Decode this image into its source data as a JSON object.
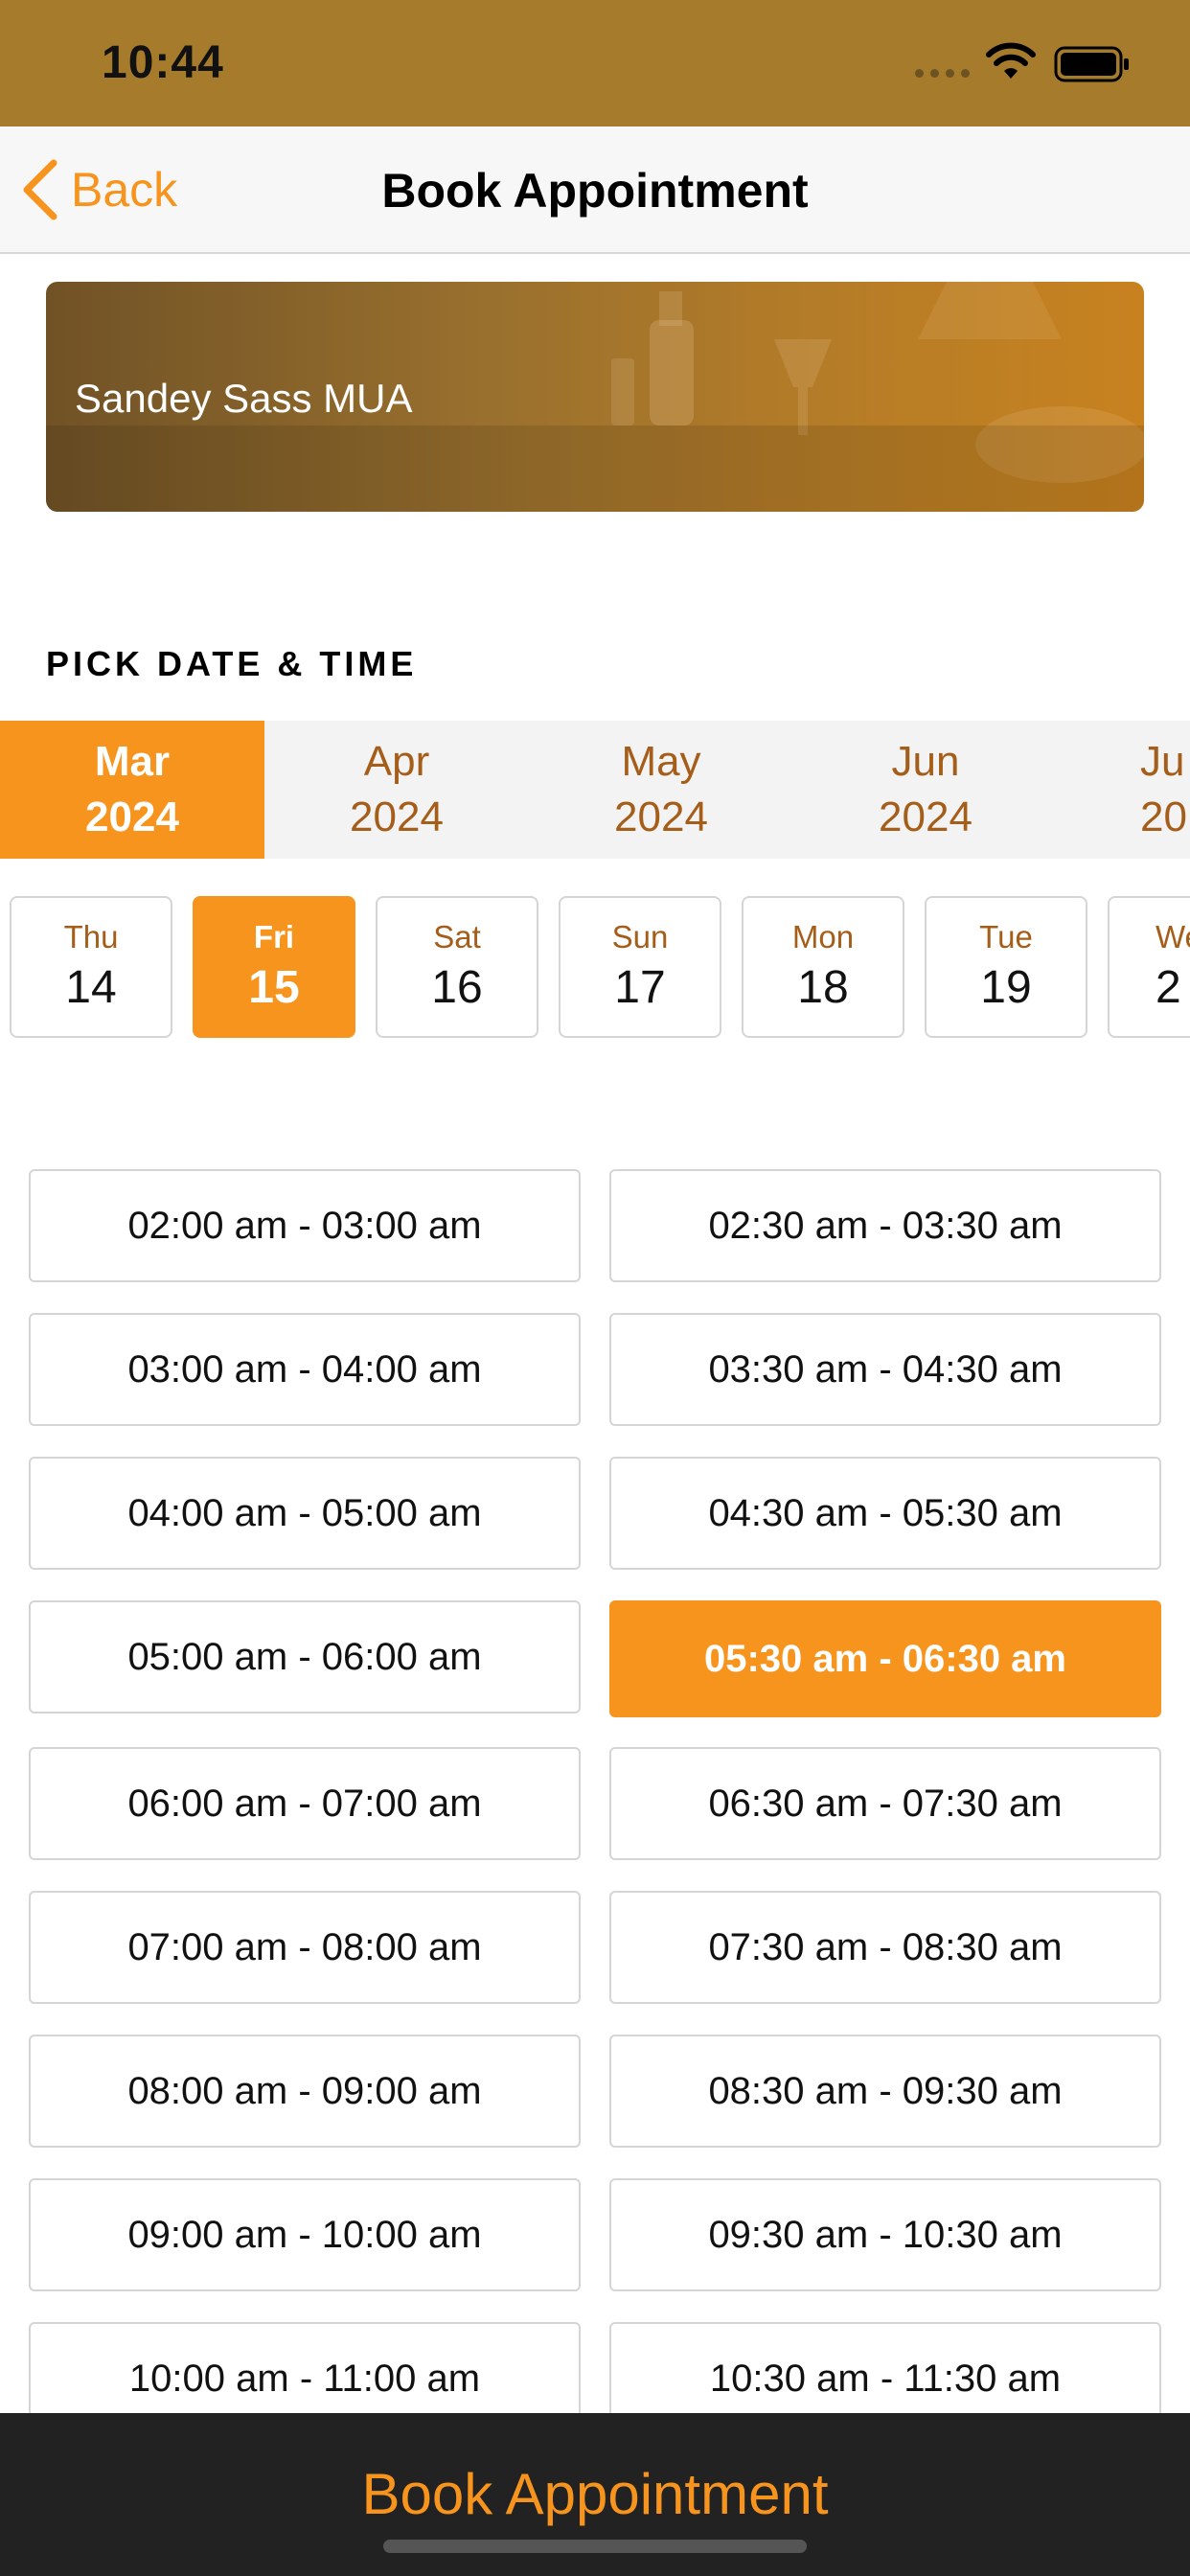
{
  "status_bar": {
    "time": "10:44"
  },
  "nav": {
    "back_label": "Back",
    "title": "Book Appointment"
  },
  "banner": {
    "name": "Sandey Sass MUA"
  },
  "section": {
    "label": "PICK DATE & TIME"
  },
  "months": [
    {
      "month": "Mar",
      "year": "2024",
      "selected": true
    },
    {
      "month": "Apr",
      "year": "2024",
      "selected": false
    },
    {
      "month": "May",
      "year": "2024",
      "selected": false
    },
    {
      "month": "Jun",
      "year": "2024",
      "selected": false
    },
    {
      "month": "Ju",
      "year": "20",
      "selected": false
    }
  ],
  "days": [
    {
      "name": "Thu",
      "num": "14",
      "selected": false
    },
    {
      "name": "Fri",
      "num": "15",
      "selected": true
    },
    {
      "name": "Sat",
      "num": "16",
      "selected": false
    },
    {
      "name": "Sun",
      "num": "17",
      "selected": false
    },
    {
      "name": "Mon",
      "num": "18",
      "selected": false
    },
    {
      "name": "Tue",
      "num": "19",
      "selected": false
    },
    {
      "name": "We",
      "num": "2",
      "selected": false
    }
  ],
  "slots": [
    {
      "label": "02:00 am - 03:00 am",
      "selected": false
    },
    {
      "label": "02:30 am - 03:30 am",
      "selected": false
    },
    {
      "label": "03:00 am - 04:00 am",
      "selected": false
    },
    {
      "label": "03:30 am - 04:30 am",
      "selected": false
    },
    {
      "label": "04:00 am - 05:00 am",
      "selected": false
    },
    {
      "label": "04:30 am - 05:30 am",
      "selected": false
    },
    {
      "label": "05:00 am - 06:00 am",
      "selected": false
    },
    {
      "label": "05:30 am - 06:30 am",
      "selected": true
    },
    {
      "label": "06:00 am - 07:00 am",
      "selected": false
    },
    {
      "label": "06:30 am - 07:30 am",
      "selected": false
    },
    {
      "label": "07:00 am - 08:00 am",
      "selected": false
    },
    {
      "label": "07:30 am - 08:30 am",
      "selected": false
    },
    {
      "label": "08:00 am - 09:00 am",
      "selected": false
    },
    {
      "label": "08:30 am - 09:30 am",
      "selected": false
    },
    {
      "label": "09:00 am - 10:00 am",
      "selected": false
    },
    {
      "label": "09:30 am - 10:30 am",
      "selected": false
    },
    {
      "label": "10:00 am - 11:00 am",
      "selected": false
    },
    {
      "label": "10:30 am - 11:30 am",
      "selected": false
    }
  ],
  "bottom": {
    "button_label": "Book Appointment"
  },
  "colors": {
    "accent": "#f7941e",
    "status_bar": "#a67c2c",
    "month_text": "#a55e1a",
    "bottom_bar": "#222222"
  }
}
